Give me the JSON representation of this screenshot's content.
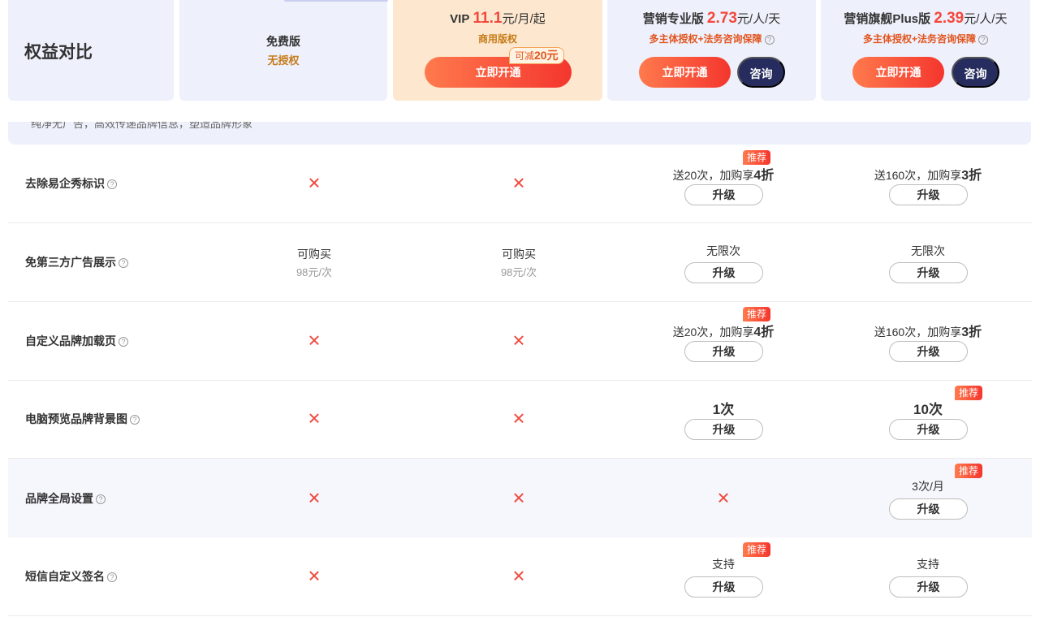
{
  "header": {
    "title": "权益对比",
    "free": {
      "name": "免费版",
      "sub": "无授权"
    },
    "vip": {
      "name": "VIP",
      "price": "11.1",
      "unit": "元/月/起",
      "sub": "商用版权",
      "cta": "立即开通",
      "coupon_prefix": "可减",
      "coupon_amount": "20元"
    },
    "pro": {
      "name": "营销专业版",
      "price": "2.73",
      "unit": "元/人/天",
      "sub": "多主体授权+法务咨询保障",
      "cta": "立即开通",
      "consult": "咨询"
    },
    "plus": {
      "name": "营销旗舰Plus版",
      "price": "2.39",
      "unit": "元/人/天",
      "sub": "多主体授权+法务咨询保障",
      "cta": "立即开通",
      "consult": "咨询"
    }
  },
  "strip_text": "纯净无广告，高效传递品牌信息，塑造品牌形象",
  "common": {
    "upgrade": "升级",
    "recommend": "推荐",
    "cross": "✕",
    "help": "?"
  },
  "rows": [
    {
      "label": "去除易企秀标识",
      "pro": {
        "prefix": "送20次，加购享",
        "bold": "4折"
      },
      "plus": {
        "prefix": "送160次，加购享",
        "bold": "3折"
      }
    },
    {
      "label": "免第三方广告展示",
      "free": {
        "main": "可购买",
        "sub": "98元/次"
      },
      "vip": {
        "main": "可购买",
        "sub": "98元/次"
      },
      "pro": {
        "main": "无限次"
      },
      "plus": {
        "main": "无限次"
      }
    },
    {
      "label": "自定义品牌加载页",
      "pro": {
        "prefix": "送20次，加购享",
        "bold": "4折"
      },
      "plus": {
        "prefix": "送160次，加购享",
        "bold": "3折"
      }
    },
    {
      "label": "电脑预览品牌背景图",
      "pro": {
        "big": "1次"
      },
      "plus": {
        "big": "10次"
      }
    },
    {
      "label": "品牌全局设置",
      "plus": {
        "main": "3次/月"
      }
    },
    {
      "label": "短信自定义签名",
      "pro": {
        "main": "支持"
      },
      "plus": {
        "main": "支持"
      }
    }
  ],
  "colors": {
    "accent": "#f4473d",
    "navy": "#262d5e",
    "gold": "#c77b1a",
    "vip_bg": "#fde8cf",
    "panel_bg": "#eef0fb"
  }
}
